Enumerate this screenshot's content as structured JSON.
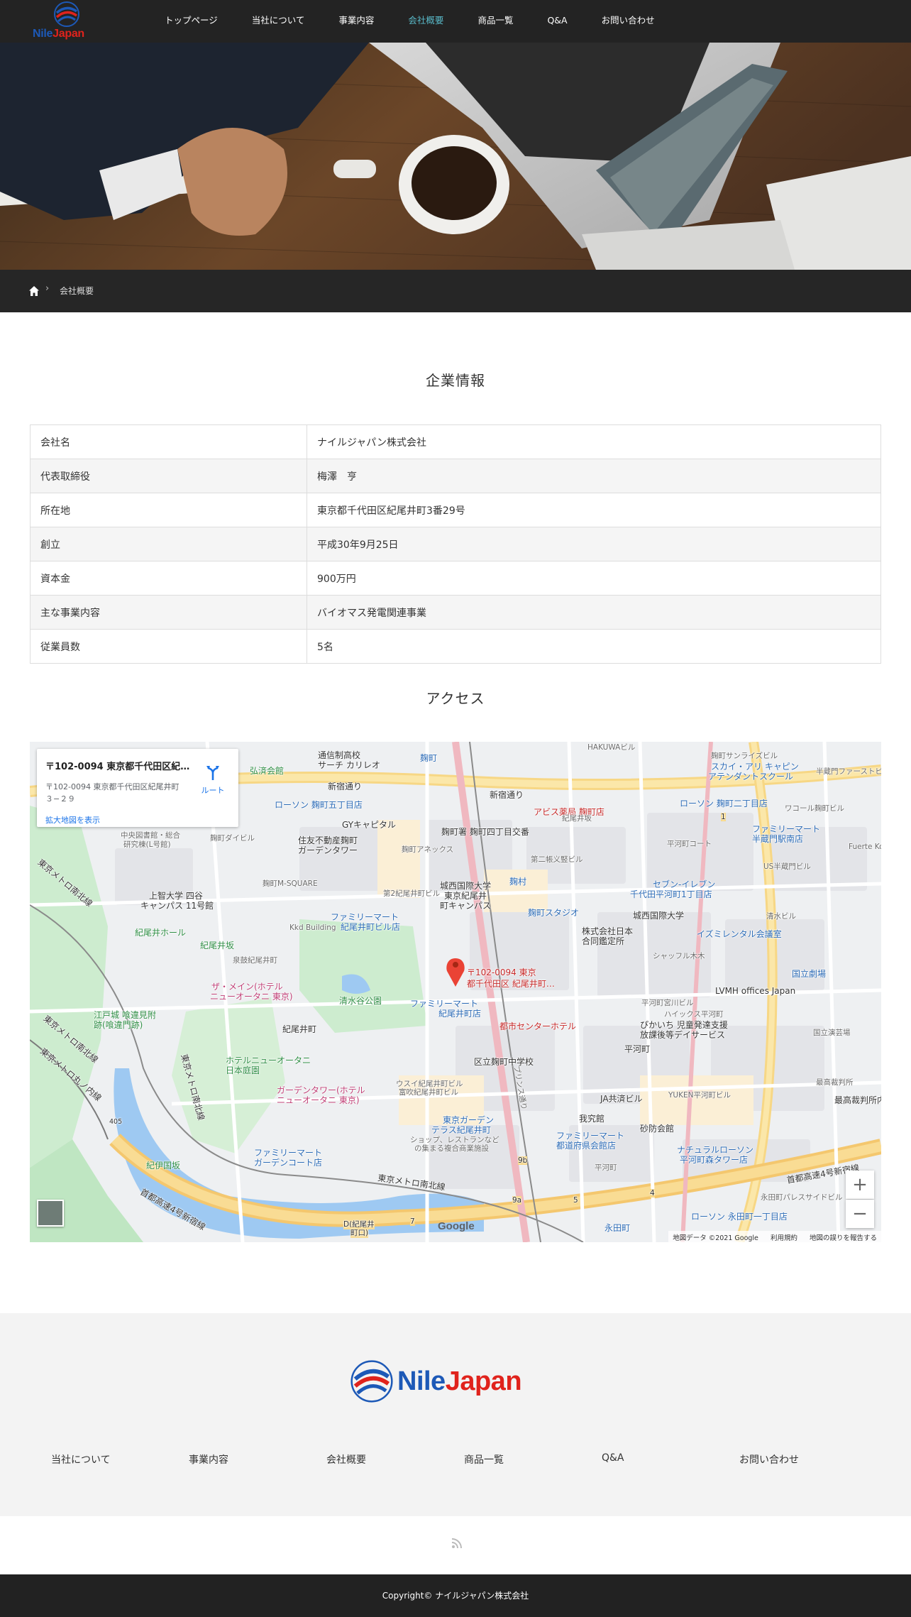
{
  "header": {
    "logo_nile": "Nile",
    "logo_japan": "Japan",
    "nav": [
      "トップページ",
      "当社について",
      "事業内容",
      "会社概要",
      "商品一覧",
      "Q&A",
      "お問い合わせ"
    ],
    "active_index": 3
  },
  "breadcrumb": {
    "separator": "›",
    "current": "会社概要"
  },
  "company": {
    "heading": "企業情報",
    "rows": [
      {
        "label": "会社名",
        "value": "ナイルジャパン株式会社"
      },
      {
        "label": "代表取締役",
        "value": "梅澤　亨"
      },
      {
        "label": "所在地",
        "value": "東京都千代田区紀尾井町3番29号"
      },
      {
        "label": "創立",
        "value": "平成30年9月25日"
      },
      {
        "label": "資本金",
        "value": "900万円"
      },
      {
        "label": "主な事業内容",
        "value": "バイオマス発電関連事業"
      },
      {
        "label": "従業員数",
        "value": "5名"
      }
    ]
  },
  "access": {
    "heading": "アクセス",
    "map": {
      "infobox_title": "〒102-0094 東京都千代田区紀尾井町3-29",
      "infobox_address_1": "〒102-0094 東京都千代田区紀尾井町",
      "infobox_address_2": "３−２９",
      "directions_label": "ルート",
      "larger_map_link": "拡大地図を表示",
      "pin_label_1": "〒102-0094 東京",
      "pin_label_2": "都千代田区 紀尾井町…",
      "zoom_in": "+",
      "zoom_out": "−",
      "google_logo": "Google",
      "attribution": "地図データ ©2021 Google",
      "terms": "利用規約",
      "report": "地図の誤りを報告する",
      "places": [
        {
          "text": "通信制高校",
          "cls": "dark"
        },
        {
          "text": "サーチ カリレオ",
          "cls": "dark"
        },
        {
          "text": "弘済会館",
          "cls": "green"
        },
        {
          "text": "麹町",
          "cls": "blue"
        },
        {
          "text": "新宿通り",
          "cls": "dark"
        },
        {
          "text": "新宿通り",
          "cls": "dark"
        },
        {
          "text": "ローソン 麹町五丁目店",
          "cls": "blue"
        },
        {
          "text": "アビス薬局 麹町店",
          "cls": "red"
        },
        {
          "text": "ローソン 麹町二丁目店",
          "cls": "blue"
        },
        {
          "text": "スカイ・アリ キャピン",
          "cls": "blue"
        },
        {
          "text": "アテンダントスクール",
          "cls": "blue"
        },
        {
          "text": "GYキャピタル",
          "cls": "dark"
        },
        {
          "text": "麹町署 麹町四丁目交番",
          "cls": "dark"
        },
        {
          "text": "ファミリーマート",
          "cls": "blue"
        },
        {
          "text": "半蔵門駅南店",
          "cls": "blue"
        },
        {
          "text": "住友不動産麹町",
          "cls": "dark"
        },
        {
          "text": "ガーデンタワー",
          "cls": "dark"
        },
        {
          "text": "麹町アネックス",
          "cls": "gray"
        },
        {
          "text": "麹町ダイビル",
          "cls": "gray"
        },
        {
          "text": "中央図書館・総合",
          "cls": "gray"
        },
        {
          "text": "研究棟(L号館)",
          "cls": "gray"
        },
        {
          "text": "平河町コート",
          "cls": "gray"
        },
        {
          "text": "US半蔵門ビル",
          "cls": "gray"
        },
        {
          "text": "ワコール麹町ビル",
          "cls": "gray"
        },
        {
          "text": "Fuerte Ko",
          "cls": "gray"
        },
        {
          "text": "第二帳义竪ビル",
          "cls": "gray"
        },
        {
          "text": "紀尾井坂",
          "cls": "gray"
        },
        {
          "text": "麹町M-SQUARE",
          "cls": "gray"
        },
        {
          "text": "第2紀尾井町ビル",
          "cls": "gray"
        },
        {
          "text": "城西国際大学",
          "cls": "dark"
        },
        {
          "text": "東京紀尾井",
          "cls": "dark"
        },
        {
          "text": "町キャンパス",
          "cls": "dark"
        },
        {
          "text": "麹村",
          "cls": "blue"
        },
        {
          "text": "セブン-イレブン",
          "cls": "blue"
        },
        {
          "text": "千代田平河町1丁目店",
          "cls": "blue"
        },
        {
          "text": "上智大学 四谷",
          "cls": "dark"
        },
        {
          "text": "キャンパス 11号館",
          "cls": "dark"
        },
        {
          "text": "麹町スタジオ",
          "cls": "blue"
        },
        {
          "text": "城西国際大学",
          "cls": "dark"
        },
        {
          "text": "株式会社日本",
          "cls": "dark"
        },
        {
          "text": "合同鑑定所",
          "cls": "dark"
        },
        {
          "text": "イズミレンタル会議室",
          "cls": "blue"
        },
        {
          "text": "清水ビル",
          "cls": "gray"
        },
        {
          "text": "ファミリーマート",
          "cls": "blue"
        },
        {
          "text": "紀尾井町ビル店",
          "cls": "blue"
        },
        {
          "text": "紀尾井ホール",
          "cls": "green"
        },
        {
          "text": "紀尾井坂",
          "cls": "green"
        },
        {
          "text": "Kkd Building",
          "cls": "gray"
        },
        {
          "text": "泉鼓紀尾井町",
          "cls": "gray"
        },
        {
          "text": "シャッフル木木",
          "cls": "gray"
        },
        {
          "text": "国立劇場",
          "cls": "blue"
        },
        {
          "text": "LVMH offices Japan",
          "cls": "dark"
        },
        {
          "text": "ザ・メイン(ホテル",
          "cls": "pink"
        },
        {
          "text": "ニューオータニ 東京)",
          "cls": "pink"
        },
        {
          "text": "清水谷公園",
          "cls": "green"
        },
        {
          "text": "ファミリーマート",
          "cls": "blue"
        },
        {
          "text": "紀尾井町店",
          "cls": "blue"
        },
        {
          "text": "平河町宮川ビル",
          "cls": "gray"
        },
        {
          "text": "ハイックス平河町",
          "cls": "gray"
        },
        {
          "text": "江戸城 喰違見附",
          "cls": "green"
        },
        {
          "text": "跡(喰違門跡)",
          "cls": "green"
        },
        {
          "text": "都市センターホテル",
          "cls": "red"
        },
        {
          "text": "ぴかいち 児童発達支援",
          "cls": "dark"
        },
        {
          "text": "放課後等デイサービス",
          "cls": "dark"
        },
        {
          "text": "国立演芸場",
          "cls": "gray"
        },
        {
          "text": "紀尾井町",
          "cls": "dark"
        },
        {
          "text": "平河町",
          "cls": "dark"
        },
        {
          "text": "ホテルニューオータニ",
          "cls": "green"
        },
        {
          "text": "日本庭園",
          "cls": "green"
        },
        {
          "text": "区立麹町中学校",
          "cls": "dark"
        },
        {
          "text": "最高裁判所",
          "cls": "gray"
        },
        {
          "text": "ガーデンタワー(ホテル",
          "cls": "pink"
        },
        {
          "text": "ニューオータニ 東京)",
          "cls": "pink"
        },
        {
          "text": "ウスイ紀尾井町ビル",
          "cls": "gray"
        },
        {
          "text": "富吹紀尾井町ビル",
          "cls": "gray"
        },
        {
          "text": "JA共済ビル",
          "cls": "dark"
        },
        {
          "text": "YUKEN平河町ビル",
          "cls": "gray"
        },
        {
          "text": "最高裁判所内郵便",
          "cls": "dark"
        },
        {
          "text": "東京ガーデン",
          "cls": "blue"
        },
        {
          "text": "テラス紀尾井町",
          "cls": "blue"
        },
        {
          "text": "ショップ、レストランなど",
          "cls": "gray"
        },
        {
          "text": "の集まる複合商業施設",
          "cls": "gray"
        },
        {
          "text": "我究館",
          "cls": "dark"
        },
        {
          "text": "砂防会館",
          "cls": "dark"
        },
        {
          "text": "ファミリーマート",
          "cls": "blue"
        },
        {
          "text": "都道府県会館店",
          "cls": "blue"
        },
        {
          "text": "ナチュラルローソン",
          "cls": "blue"
        },
        {
          "text": "平河町森タワー店",
          "cls": "blue"
        },
        {
          "text": "ファミリーマート",
          "cls": "blue"
        },
        {
          "text": "ガーデンコート店",
          "cls": "blue"
        },
        {
          "text": "紀伊国坂",
          "cls": "green"
        },
        {
          "text": "平河町",
          "cls": "gray"
        },
        {
          "text": "首都高速4号新宿線",
          "cls": "dark"
        },
        {
          "text": "首都高速4号新宿線",
          "cls": "dark"
        },
        {
          "text": "東京メトロ南北線",
          "cls": "dark"
        },
        {
          "text": "東京メトロ南北線",
          "cls": "dark"
        },
        {
          "text": "東京メトロ南北線",
          "cls": "dark"
        },
        {
          "text": "東京メトロ丸ノ内線",
          "cls": "dark"
        },
        {
          "text": "東京メトロ南北線",
          "cls": "dark"
        },
        {
          "text": "永田町パレスサイドビル",
          "cls": "gray"
        },
        {
          "text": "ローソン 永田町一丁目店",
          "cls": "blue"
        },
        {
          "text": "永田町",
          "cls": "blue"
        },
        {
          "text": "D(紀尾井",
          "cls": "dark"
        },
        {
          "text": "町口)",
          "cls": "dark"
        },
        {
          "text": "プリンス通り",
          "cls": "gray"
        },
        {
          "text": "HAKUWAビル",
          "cls": "gray"
        },
        {
          "text": "麹町サンライズビル",
          "cls": "gray"
        },
        {
          "text": "半蔵門ファーストビル",
          "cls": "gray"
        },
        {
          "text": "9b",
          "cls": "dark"
        },
        {
          "text": "9a",
          "cls": "dark"
        },
        {
          "text": "5",
          "cls": "dark"
        },
        {
          "text": "4",
          "cls": "dark"
        },
        {
          "text": "7",
          "cls": "dark"
        },
        {
          "text": "1",
          "cls": "dark"
        },
        {
          "text": "405",
          "cls": "dark"
        }
      ]
    }
  },
  "footer": {
    "logo_nile": "Nile",
    "logo_japan": "Japan",
    "nav": [
      "当社について",
      "事業内容",
      "会社概要",
      "商品一覧",
      "Q&A",
      "お問い合わせ"
    ],
    "copyright": "Copyright©  ナイルジャパン株式会社"
  },
  "icons": {
    "home": "home-icon",
    "rss": "rss-icon",
    "directions": "directions-icon",
    "pin": "map-pin-icon"
  },
  "colors": {
    "header_bg": "#232323",
    "nav_active": "#59b9c8",
    "brand_blue": "#1d59b7",
    "brand_red": "#e0231c",
    "footer_bg": "#f3f3f3",
    "copyright_bg": "#222222",
    "link_blue": "#1a73e8"
  }
}
